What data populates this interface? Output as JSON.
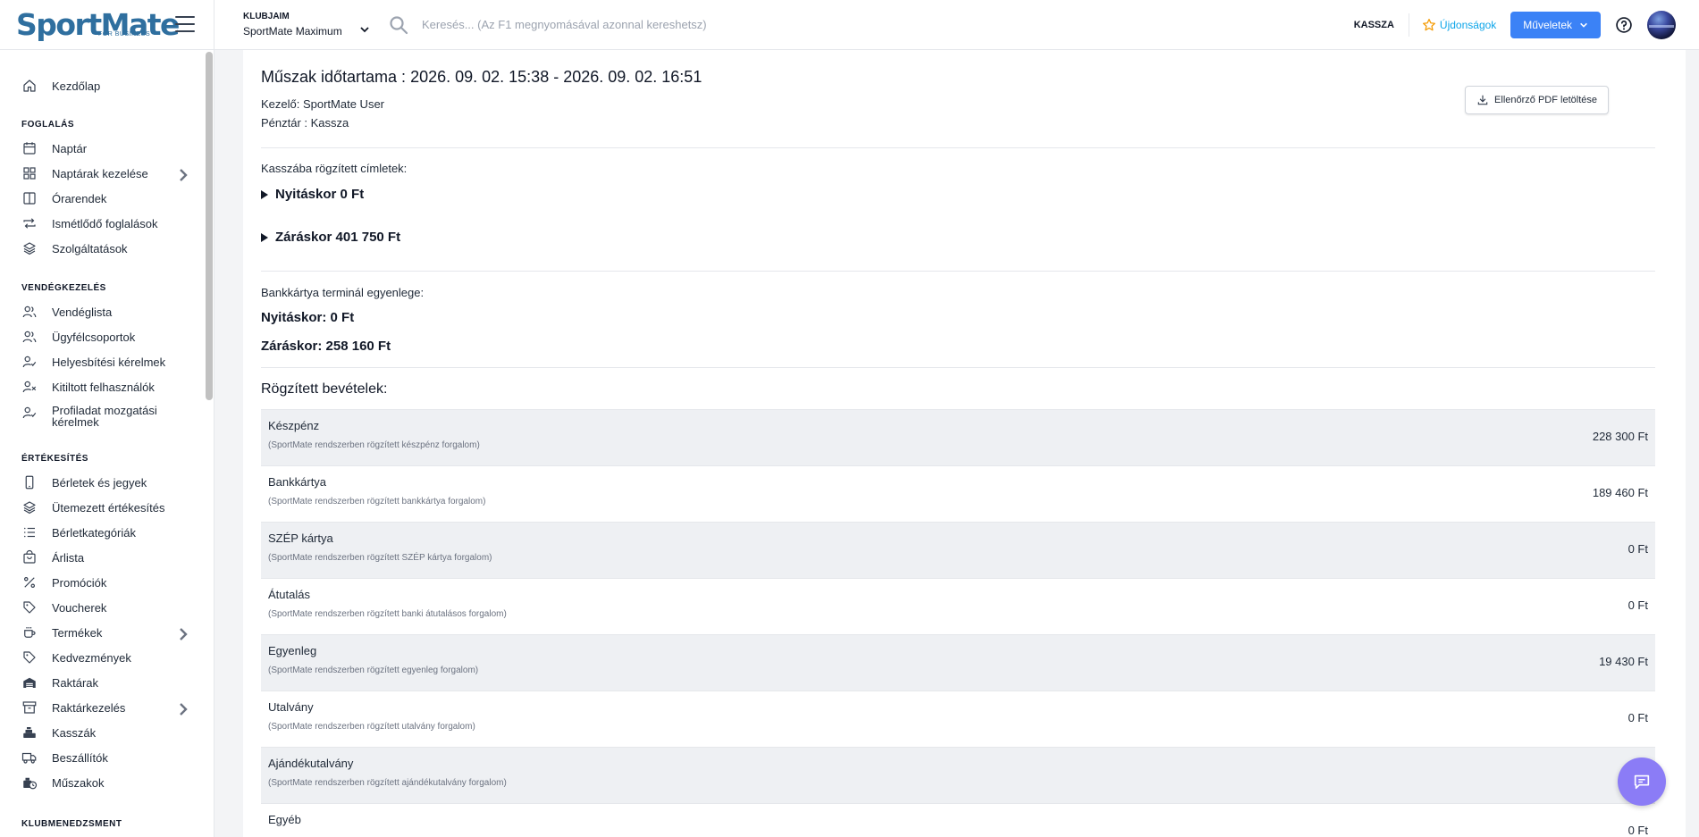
{
  "brand": {
    "logo": "SportMate",
    "tagline": "FOR BUSINESS"
  },
  "header": {
    "club_label": "KLUBJAIM",
    "club_name": "SportMate Maximum",
    "search_placeholder": "Keresés... (Az F1 megnyomásával azonnal kereshetsz)",
    "kassza": "KASSZA",
    "news": "Újdonságok",
    "actions": "Műveletek"
  },
  "sidebar": {
    "home": "Kezdőlap",
    "sections": {
      "booking": "FOGLALÁS",
      "guests": "VENDÉGKEZELÉS",
      "sales": "ÉRTÉKESÍTÉS",
      "club": "KLUBMENEDZSMENT"
    },
    "booking_items": [
      "Naptár",
      "Naptárak kezelése",
      "Órarendek",
      "Ismétlődő foglalások",
      "Szolgáltatások"
    ],
    "guest_items": [
      "Vendéglista",
      "Ügyfélcsoportok",
      "Helyesbítési kérelmek",
      "Kitiltott felhasználók",
      "Profiladat mozgatási kérelmek"
    ],
    "sales_items": [
      "Bérletek és jegyek",
      "Ütemezett értékesítés",
      "Bérletkategóriák",
      "Árlista",
      "Promóciók",
      "Voucherek",
      "Termékek",
      "Kedvezmények",
      "Raktárak",
      "Raktárkezelés",
      "Kasszák",
      "Beszállítók",
      "Műszakok"
    ]
  },
  "shift": {
    "title": "Műszak időtartama : 2026. 09. 02. 15:38 - 2026. 09. 02. 16:51",
    "operator": "Kezelő: SportMate User",
    "register": "Pénztár : Kassza",
    "pdf_button": "Ellenőrző PDF letöltése",
    "notes_label": "Kasszába rögzített címletek:",
    "notes_opening": "Nyitáskor 0 Ft",
    "notes_closing": "Záráskor 401 750 Ft",
    "terminal_label": "Bankkártya terminál egyenlege:",
    "terminal_opening": "Nyitáskor: 0 Ft",
    "terminal_closing": "Záráskor: 258 160 Ft",
    "revenues_title": "Rögzített bevételek:",
    "revenues": [
      {
        "name": "Készpénz",
        "desc": "(SportMate rendszerben rögzített készpénz forgalom)",
        "value": "228 300 Ft"
      },
      {
        "name": "Bankkártya",
        "desc": "(SportMate rendszerben rögzített bankkártya forgalom)",
        "value": "189 460 Ft"
      },
      {
        "name": "SZÉP kártya",
        "desc": "(SportMate rendszerben rögzített SZÉP kártya forgalom)",
        "value": "0 Ft"
      },
      {
        "name": "Átutalás",
        "desc": "(SportMate rendszerben rögzített banki átutalásos forgalom)",
        "value": "0 Ft"
      },
      {
        "name": "Egyenleg",
        "desc": "(SportMate rendszerben rögzített egyenleg forgalom)",
        "value": "19 430 Ft"
      },
      {
        "name": "Utalvány",
        "desc": "(SportMate rendszerben rögzített utalvány forgalom)",
        "value": "0 Ft"
      },
      {
        "name": "Ajándékutalvány",
        "desc": "(SportMate rendszerben rögzített ajándékutalvány forgalom)",
        "value": ""
      },
      {
        "name": "Egyéb",
        "desc": "",
        "value": "0 Ft"
      }
    ]
  },
  "colors": {
    "brand": "#2f6f9f",
    "primary": "#3b82f6",
    "news": "#0ea5e9",
    "chat": "#8b7cf6"
  }
}
